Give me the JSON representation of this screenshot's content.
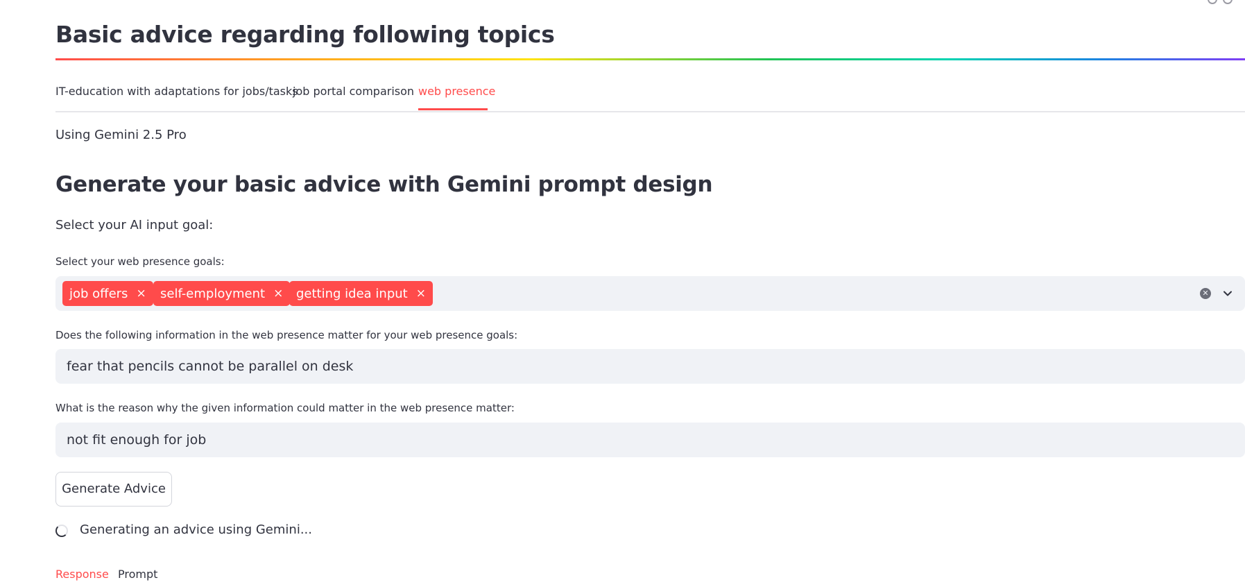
{
  "page": {
    "title": "Basic advice regarding following topics"
  },
  "tabs": [
    {
      "label": "IT-education with adaptations for jobs/tasks",
      "active": false
    },
    {
      "label": "job portal comparison",
      "active": false
    },
    {
      "label": "web presence",
      "active": true
    }
  ],
  "model_info": "Using Gemini 2.5 Pro",
  "section": {
    "heading": "Generate your basic advice with Gemini prompt design",
    "goal_prompt": "Select your AI input goal:"
  },
  "goals_select": {
    "label": "Select your web presence goals:",
    "selected": [
      "job offers",
      "self-employment",
      "getting idea input"
    ],
    "remove_glyph": "×",
    "clear_icon": "clear-circle-icon",
    "dropdown_icon": "chevron-down-icon"
  },
  "info_field": {
    "label": "Does the following information in the web presence matter for your web presence goals:",
    "value": "fear that pencils cannot be parallel on desk"
  },
  "reason_field": {
    "label": "What is the reason why the given information could matter in the web presence matter:",
    "value": "not fit enough for job"
  },
  "generate_button": {
    "label": "Generate Advice"
  },
  "status": {
    "text": "Generating an advice using Gemini..."
  },
  "result_tabs": [
    {
      "label": "Response",
      "active": true
    },
    {
      "label": "Prompt",
      "active": false
    }
  ],
  "colors": {
    "accent": "#ff4b4b",
    "text": "#31333f",
    "input_bg": "#f0f2f6"
  }
}
